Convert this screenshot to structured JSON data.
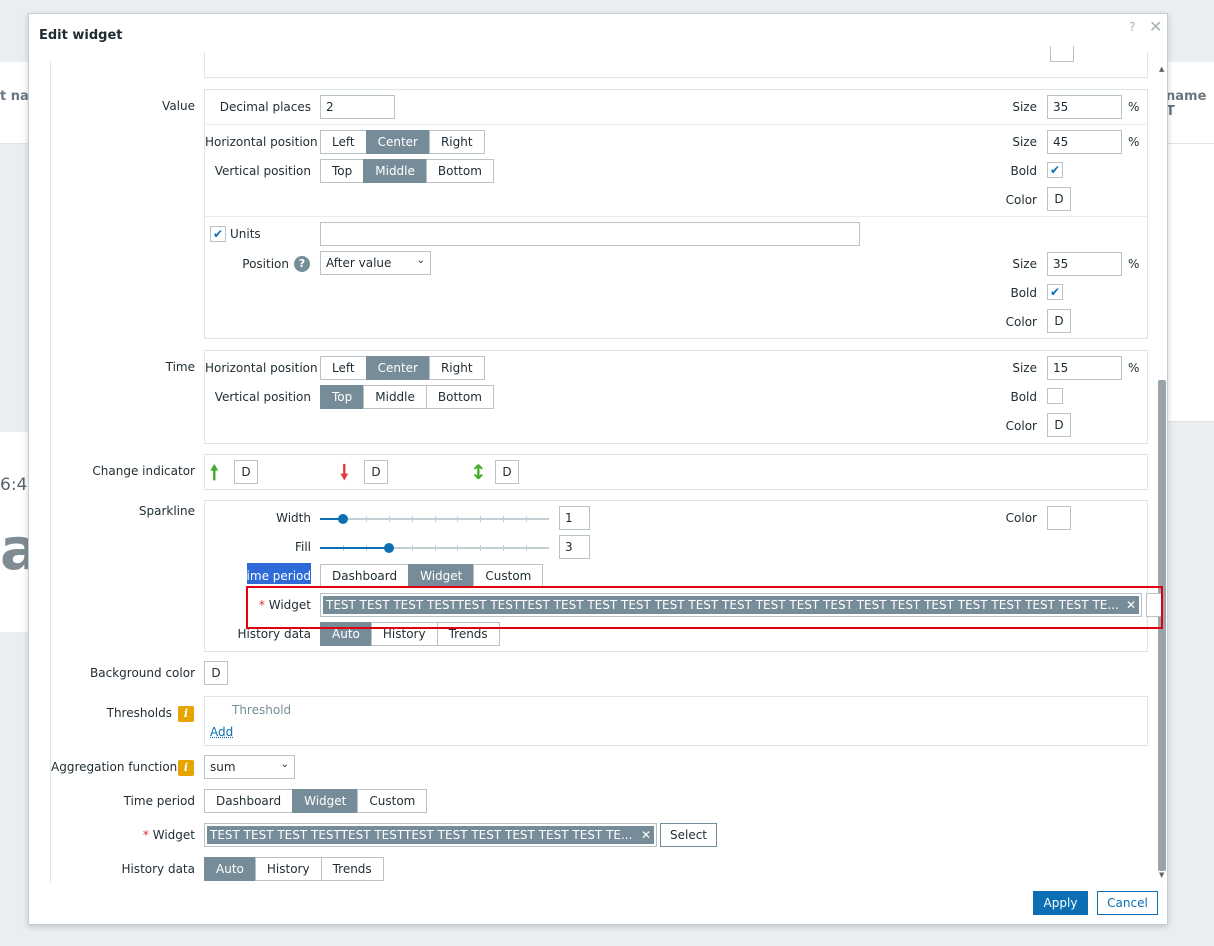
{
  "background": {
    "left_header": "t na",
    "right_header": "name T",
    "time": "6:4",
    "big": "at"
  },
  "dialog": {
    "title": "Edit widget",
    "help_icon": "?",
    "close_icon": "✕"
  },
  "value": {
    "section_label": "Value",
    "decimal_places_label": "Decimal places",
    "decimal_places": "2",
    "size_label": "Size",
    "size1": "35",
    "size2": "45",
    "size3": "35",
    "pct": "%",
    "hpos_label": "Horizontal position",
    "hpos_options": [
      "Left",
      "Center",
      "Right"
    ],
    "hpos_selected": "Center",
    "vpos_label": "Vertical position",
    "vpos_options": [
      "Top",
      "Middle",
      "Bottom"
    ],
    "vpos_selected": "Middle",
    "bold_label": "Bold",
    "color_label": "Color",
    "color_value": "D",
    "units_label": "Units",
    "units_value": "",
    "position_label": "Position",
    "position_value": "After value"
  },
  "time": {
    "section_label": "Time",
    "hpos_label": "Horizontal position",
    "hpos_options": [
      "Left",
      "Center",
      "Right"
    ],
    "hpos_selected": "Center",
    "vpos_label": "Vertical position",
    "vpos_options": [
      "Top",
      "Middle",
      "Bottom"
    ],
    "vpos_selected": "Top",
    "size_label": "Size",
    "size": "15",
    "pct": "%",
    "bold_label": "Bold",
    "color_label": "Color",
    "color_value": "D"
  },
  "change_indicator": {
    "label": "Change indicator",
    "up": "D",
    "down": "D",
    "updown": "D"
  },
  "sparkline": {
    "label": "Sparkline",
    "width_label": "Width",
    "width_value": "1",
    "width_fraction": 0.1,
    "fill_label": "Fill",
    "fill_value": "3",
    "fill_fraction": 0.3,
    "color_label": "Color",
    "time_period_label": "Time period",
    "time_period_options": [
      "Dashboard",
      "Widget",
      "Custom"
    ],
    "time_period_selected": "Widget",
    "widget_label": "Widget",
    "widget_required": "*",
    "widget_value": "TEST TEST TEST TESTTEST TESTTEST TEST TEST TEST TEST TEST TEST TEST TEST TEST TEST TEST TEST TEST TEST TEST TEST TE...",
    "history_label": "History data",
    "history_options": [
      "Auto",
      "History",
      "Trends"
    ],
    "history_selected": "Auto"
  },
  "background_color": {
    "label": "Background color",
    "value": "D"
  },
  "thresholds": {
    "label": "Thresholds",
    "column": "Threshold",
    "add": "Add"
  },
  "aggregation": {
    "label": "Aggregation function",
    "value": "sum"
  },
  "time_period": {
    "label": "Time period",
    "options": [
      "Dashboard",
      "Widget",
      "Custom"
    ],
    "selected": "Widget"
  },
  "widget": {
    "label": "Widget",
    "required": "*",
    "value": "TEST TEST TEST TESTTEST TESTTEST TEST TEST TEST TEST TEST TE...",
    "select": "Select"
  },
  "history_data": {
    "label": "History data",
    "options": [
      "Auto",
      "History",
      "Trends"
    ],
    "selected": "Auto"
  },
  "footer": {
    "apply": "Apply",
    "cancel": "Cancel"
  },
  "colors": {
    "accent": "#0c6fb3",
    "segment_on": "#768d99",
    "up_arrow": "#3dae26",
    "down_arrow": "#e3393b",
    "highlight_box": "#e0000e"
  },
  "icons": {
    "check": "check-icon",
    "help": "help-icon",
    "info": "info-icon",
    "remove": "remove-icon",
    "chevron": "chevron-down-icon"
  }
}
